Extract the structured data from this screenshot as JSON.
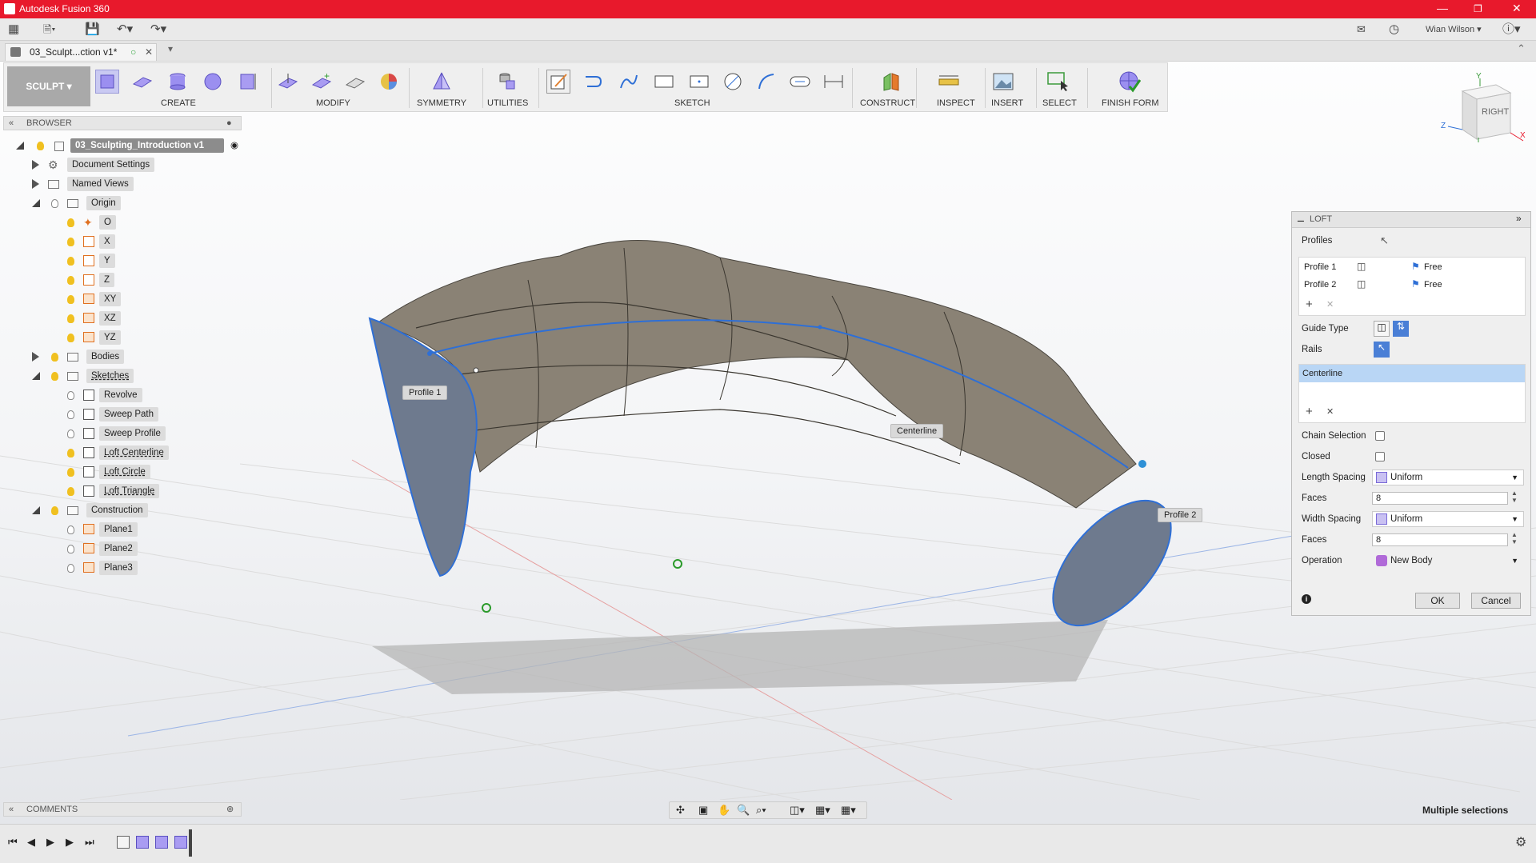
{
  "app": {
    "title": "Autodesk Fusion 360",
    "user": "Wian Wilson",
    "status": "Multiple selections"
  },
  "tab": {
    "name": "03_Sculpt...ction v1*"
  },
  "toolbar": {
    "workspace": "SCULPT",
    "groups": {
      "create": "CREATE",
      "modify": "MODIFY",
      "symmetry": "SYMMETRY",
      "utilities": "UTILITIES",
      "sketch": "SKETCH",
      "construct": "CONSTRUCT",
      "inspect": "INSPECT",
      "insert": "INSERT",
      "select": "SELECT",
      "finish": "FINISH FORM"
    }
  },
  "viewcube": {
    "face": "RIGHT",
    "axes": [
      "Y",
      "Z",
      "X"
    ]
  },
  "browser": {
    "title": "BROWSER",
    "root": "03_Sculpting_Introduction v1",
    "items": {
      "document_settings": "Document Settings",
      "named_views": "Named Views",
      "origin": "Origin",
      "o": "O",
      "x": "X",
      "y": "Y",
      "z": "Z",
      "xy": "XY",
      "xz": "XZ",
      "yz": "YZ",
      "bodies": "Bodies",
      "sketches": "Sketches",
      "revolve": "Revolve",
      "sweep_path": "Sweep Path",
      "sweep_profile": "Sweep Profile",
      "loft_centerline": "Loft Centerline",
      "loft_circle": "Loft Circle",
      "loft_triangle": "Loft Triangle",
      "construction": "Construction",
      "plane1": "Plane1",
      "plane2": "Plane2",
      "plane3": "Plane3"
    }
  },
  "viewport": {
    "callouts": {
      "profile1": "Profile 1",
      "profile2": "Profile 2",
      "centerline": "Centerline"
    }
  },
  "loft": {
    "title": "LOFT",
    "profiles_label": "Profiles",
    "profiles": [
      {
        "name": "Profile 1",
        "condition": "Free"
      },
      {
        "name": "Profile 2",
        "condition": "Free"
      }
    ],
    "guide_type_label": "Guide Type",
    "rails_label": "Rails",
    "rails": [
      "Centerline"
    ],
    "chain_selection_label": "Chain Selection",
    "chain_selection": false,
    "closed_label": "Closed",
    "closed": false,
    "length_spacing_label": "Length Spacing",
    "length_spacing": "Uniform",
    "faces_label": "Faces",
    "length_faces": "8",
    "width_spacing_label": "Width Spacing",
    "width_spacing": "Uniform",
    "width_faces": "8",
    "operation_label": "Operation",
    "operation": "New Body",
    "ok": "OK",
    "cancel": "Cancel"
  },
  "comments": {
    "title": "COMMENTS"
  },
  "colors": {
    "titlebar": "#e8192c",
    "selection": "#2e6fd6",
    "form_surface": "#8a8275",
    "rail_highlight": "#b9d6f5"
  }
}
